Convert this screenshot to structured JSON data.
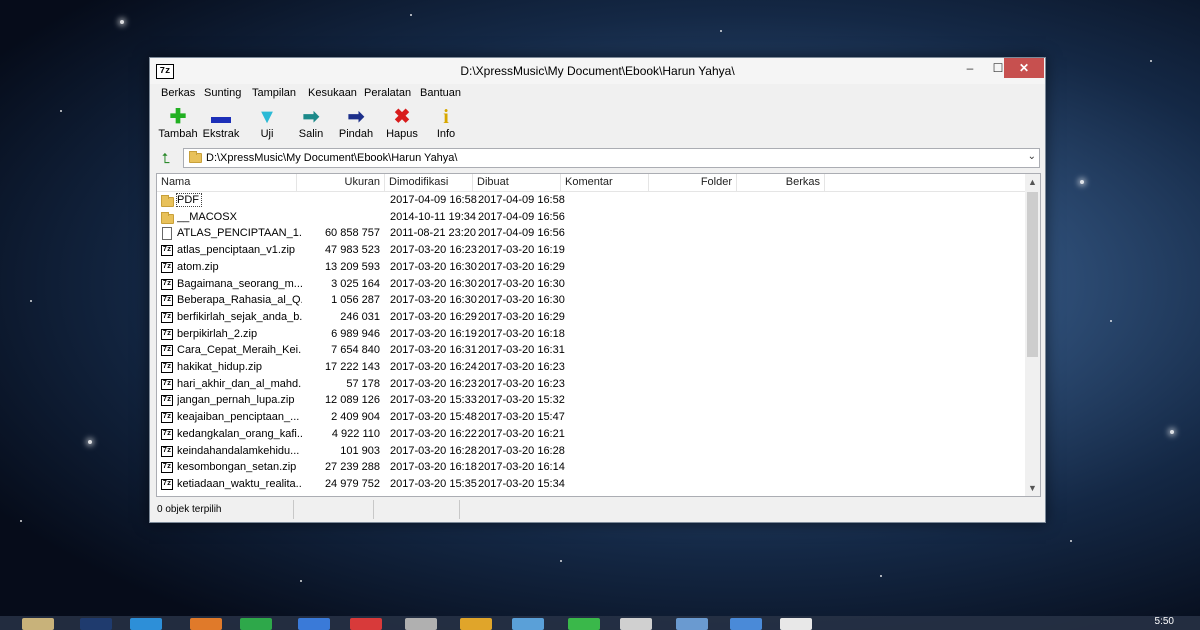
{
  "window": {
    "title": "D:\\XpressMusic\\My Document\\Ebook\\Harun Yahya\\",
    "app_icon_text": "7z",
    "min_symbol": "–",
    "max_symbol": "☐",
    "close_symbol": "✕"
  },
  "menu": [
    "Berkas",
    "Sunting",
    "Tampilan",
    "Kesukaan",
    "Peralatan",
    "Bantuan"
  ],
  "toolbar": [
    {
      "label": "Tambah",
      "icon": "plus-icon",
      "glyph": "✚",
      "color": "#22b022"
    },
    {
      "label": "Ekstrak",
      "icon": "minus-icon",
      "glyph": "▬",
      "color": "#1c2fb8"
    },
    {
      "label": "Uji",
      "icon": "check-down-icon",
      "glyph": "▼",
      "color": "#2bbad6"
    },
    {
      "label": "Salin",
      "icon": "copy-arrow-icon",
      "glyph": "➡",
      "color": "#1c8a8a"
    },
    {
      "label": "Pindah",
      "icon": "move-arrow-icon",
      "glyph": "➡",
      "color": "#1c2f8a"
    },
    {
      "label": "Hapus",
      "icon": "delete-x-icon",
      "glyph": "✖",
      "color": "#d81c1c"
    },
    {
      "label": "Info",
      "icon": "info-icon",
      "glyph": "i",
      "color": "#d8a800"
    }
  ],
  "address": {
    "path": "D:\\XpressMusic\\My Document\\Ebook\\Harun Yahya\\",
    "arrow": "⌄",
    "up_glyph": "⮤"
  },
  "columns": [
    "Nama",
    "Ukuran",
    "Dimodifikasi",
    "Dibuat",
    "Komentar",
    "Folder",
    "Berkas"
  ],
  "rows": [
    {
      "type": "folder",
      "name": "PDF",
      "size": "",
      "modified": "2017-04-09 16:58",
      "created": "2017-04-09 16:58"
    },
    {
      "type": "folder",
      "name": "__MACOSX",
      "size": "",
      "modified": "2014-10-11 19:34",
      "created": "2017-04-09 16:56"
    },
    {
      "type": "file",
      "name": "ATLAS_PENCIPTAAN_1....",
      "size": "60 858 757",
      "modified": "2011-08-21 23:20",
      "created": "2017-04-09 16:56"
    },
    {
      "type": "archive",
      "name": "atlas_penciptaan_v1.zip",
      "size": "47 983 523",
      "modified": "2017-03-20 16:23",
      "created": "2017-03-20 16:19"
    },
    {
      "type": "archive",
      "name": "atom.zip",
      "size": "13 209 593",
      "modified": "2017-03-20 16:30",
      "created": "2017-03-20 16:29"
    },
    {
      "type": "archive",
      "name": "Bagaimana_seorang_m...",
      "size": "3 025 164",
      "modified": "2017-03-20 16:30",
      "created": "2017-03-20 16:30"
    },
    {
      "type": "archive",
      "name": "Beberapa_Rahasia_al_Q...",
      "size": "1 056 287",
      "modified": "2017-03-20 16:30",
      "created": "2017-03-20 16:30"
    },
    {
      "type": "archive",
      "name": "berfikirlah_sejak_anda_b...",
      "size": "246 031",
      "modified": "2017-03-20 16:29",
      "created": "2017-03-20 16:29"
    },
    {
      "type": "archive",
      "name": "berpikirlah_2.zip",
      "size": "6 989 946",
      "modified": "2017-03-20 16:19",
      "created": "2017-03-20 16:18"
    },
    {
      "type": "archive",
      "name": "Cara_Cepat_Meraih_Kei...",
      "size": "7 654 840",
      "modified": "2017-03-20 16:31",
      "created": "2017-03-20 16:31"
    },
    {
      "type": "archive",
      "name": "hakikat_hidup.zip",
      "size": "17 222 143",
      "modified": "2017-03-20 16:24",
      "created": "2017-03-20 16:23"
    },
    {
      "type": "archive",
      "name": "hari_akhir_dan_al_mahd...",
      "size": "57 178",
      "modified": "2017-03-20 16:23",
      "created": "2017-03-20 16:23"
    },
    {
      "type": "archive",
      "name": "jangan_pernah_lupa.zip",
      "size": "12 089 126",
      "modified": "2017-03-20 15:33",
      "created": "2017-03-20 15:32"
    },
    {
      "type": "archive",
      "name": "keajaiban_penciptaan_...",
      "size": "2 409 904",
      "modified": "2017-03-20 15:48",
      "created": "2017-03-20 15:47"
    },
    {
      "type": "archive",
      "name": "kedangkalan_orang_kafi...",
      "size": "4 922 110",
      "modified": "2017-03-20 16:22",
      "created": "2017-03-20 16:21"
    },
    {
      "type": "archive",
      "name": "keindahandalamkehidu...",
      "size": "101 903",
      "modified": "2017-03-20 16:28",
      "created": "2017-03-20 16:28"
    },
    {
      "type": "archive",
      "name": "kesombongan_setan.zip",
      "size": "27 239 288",
      "modified": "2017-03-20 16:18",
      "created": "2017-03-20 16:14"
    },
    {
      "type": "archive",
      "name": "ketiadaan_waktu_realita...",
      "size": "24 979 752",
      "modified": "2017-03-20 15:35",
      "created": "2017-03-20 15:34"
    }
  ],
  "scrollbar": {
    "up": "▲",
    "down": "▼"
  },
  "status": {
    "selection": "0 objek terpilih"
  },
  "taskbar": {
    "clock": "5:50"
  }
}
